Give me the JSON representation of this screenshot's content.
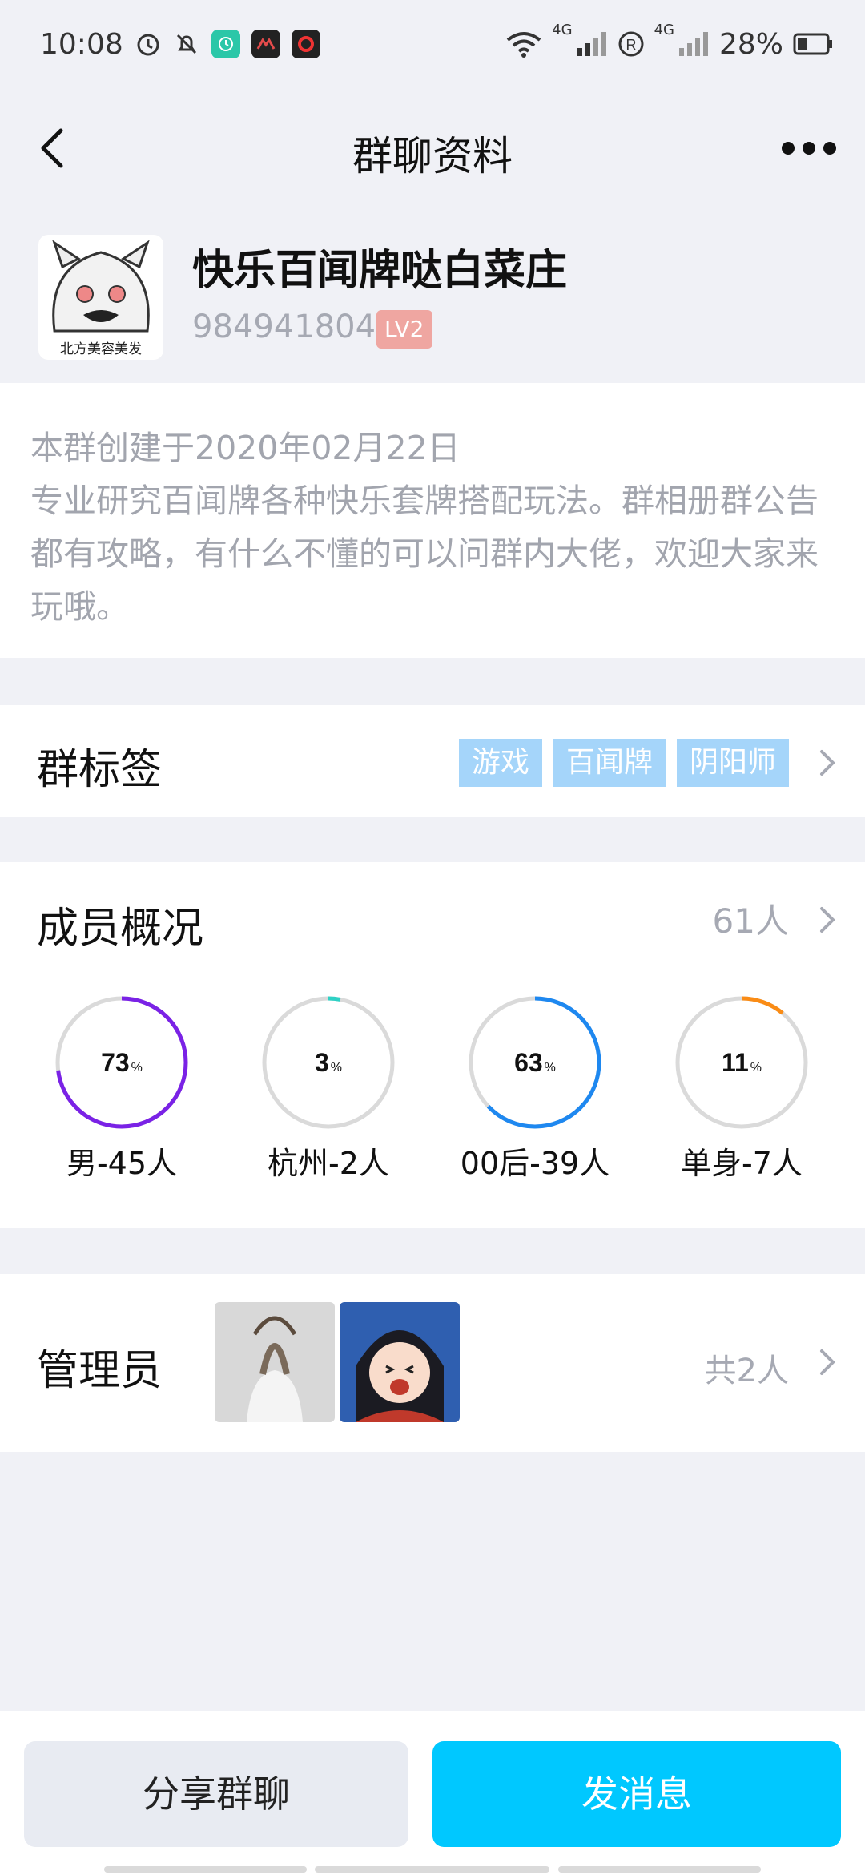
{
  "status_bar": {
    "time": "10:08",
    "battery": "28%",
    "network_1": "4G",
    "network_2": "4G"
  },
  "nav": {
    "title": "群聊资料"
  },
  "group": {
    "name": "快乐百闻牌哒白菜庄",
    "id": "984941804",
    "level": "LV2",
    "avatar_caption": "北方美容美发"
  },
  "intro": {
    "created": "本群创建于2020年02月22日",
    "description": "专业研究百闻牌各种快乐套牌搭配玩法。群相册群公告都有攻略，有什么不懂的可以问群内大佬，欢迎大家来玩哦。"
  },
  "tags": {
    "title": "群标签",
    "items": [
      "游戏",
      "百闻牌",
      "阴阳师"
    ]
  },
  "members": {
    "title": "成员概况",
    "count": "61人",
    "stats": [
      {
        "percent": 73,
        "percent_text": "73",
        "label": "男-45人",
        "color": "#7A22E6"
      },
      {
        "percent": 3,
        "percent_text": "3",
        "label": "杭州-2人",
        "color": "#2ED1C5"
      },
      {
        "percent": 63,
        "percent_text": "63",
        "label": "00后-39人",
        "color": "#1E88F0"
      },
      {
        "percent": 11,
        "percent_text": "11",
        "label": "单身-7人",
        "color": "#FA8C16"
      }
    ]
  },
  "admins": {
    "title": "管理员",
    "count": "共2人"
  },
  "actions": {
    "share": "分享群聊",
    "send": "发消息"
  }
}
